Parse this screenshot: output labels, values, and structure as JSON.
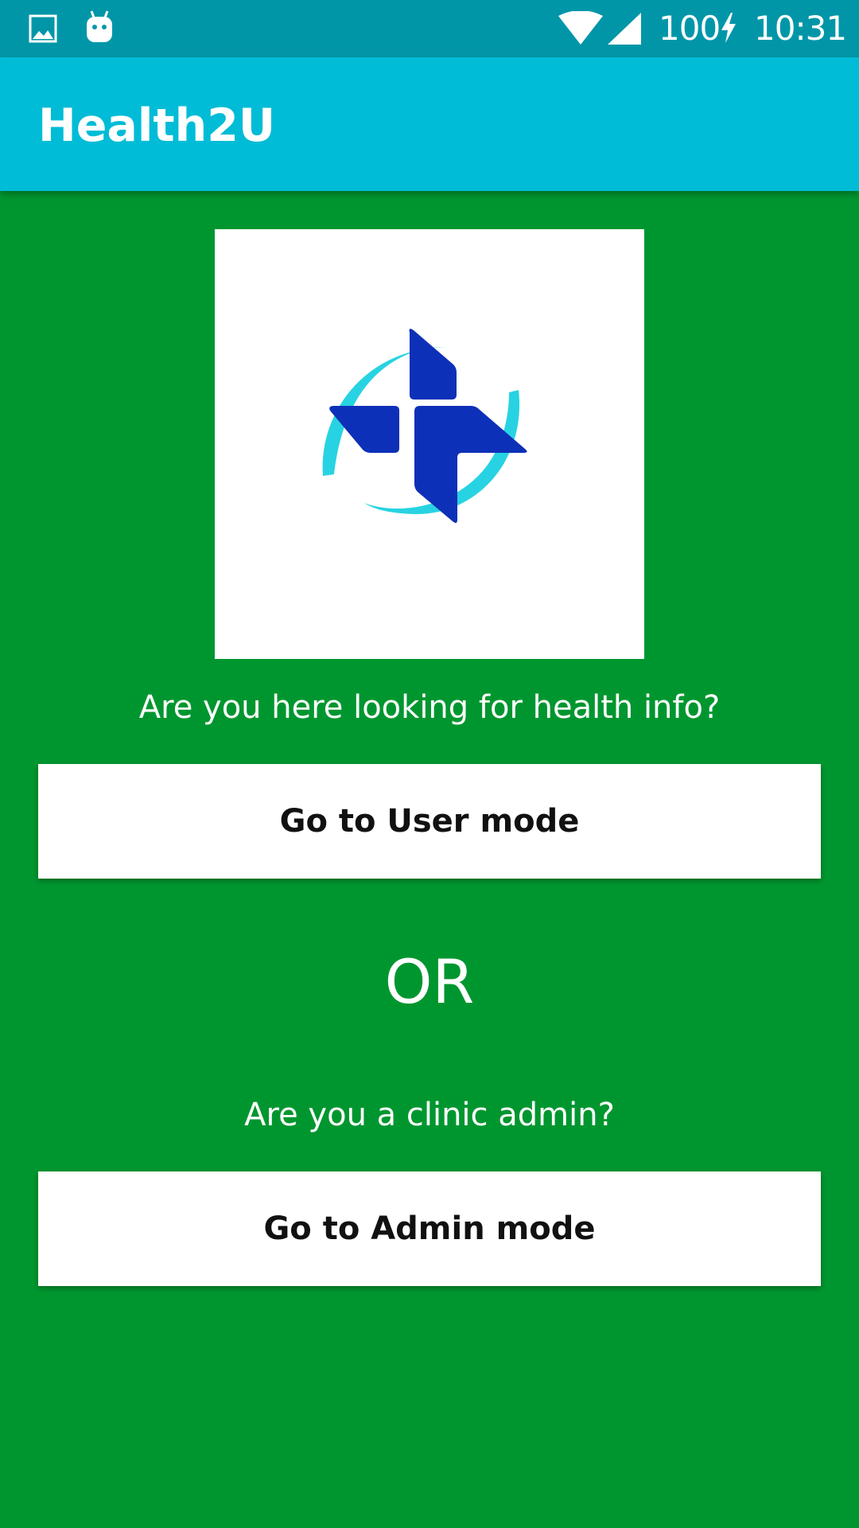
{
  "status_bar": {
    "battery": "100",
    "time": "10:31",
    "icons": [
      "gallery-icon",
      "android-icon",
      "wifi-icon",
      "signal-icon",
      "charging-bolt-icon"
    ]
  },
  "app_bar": {
    "title": "Health2U"
  },
  "main": {
    "logo_icon": "health-cross-logo-icon",
    "user_prompt": "Are you here looking for health info?",
    "user_button_label": "Go to User mode",
    "or_label": "OR",
    "admin_prompt": "Are you a clinic admin?",
    "admin_button_label": "Go to Admin mode"
  },
  "colors": {
    "status_bar": "#0096a8",
    "app_bar": "#00bcd6",
    "background": "#00962f",
    "logo_cross": "#0d30b8",
    "logo_swoosh": "#27d3e2",
    "button_bg": "#ffffff"
  }
}
